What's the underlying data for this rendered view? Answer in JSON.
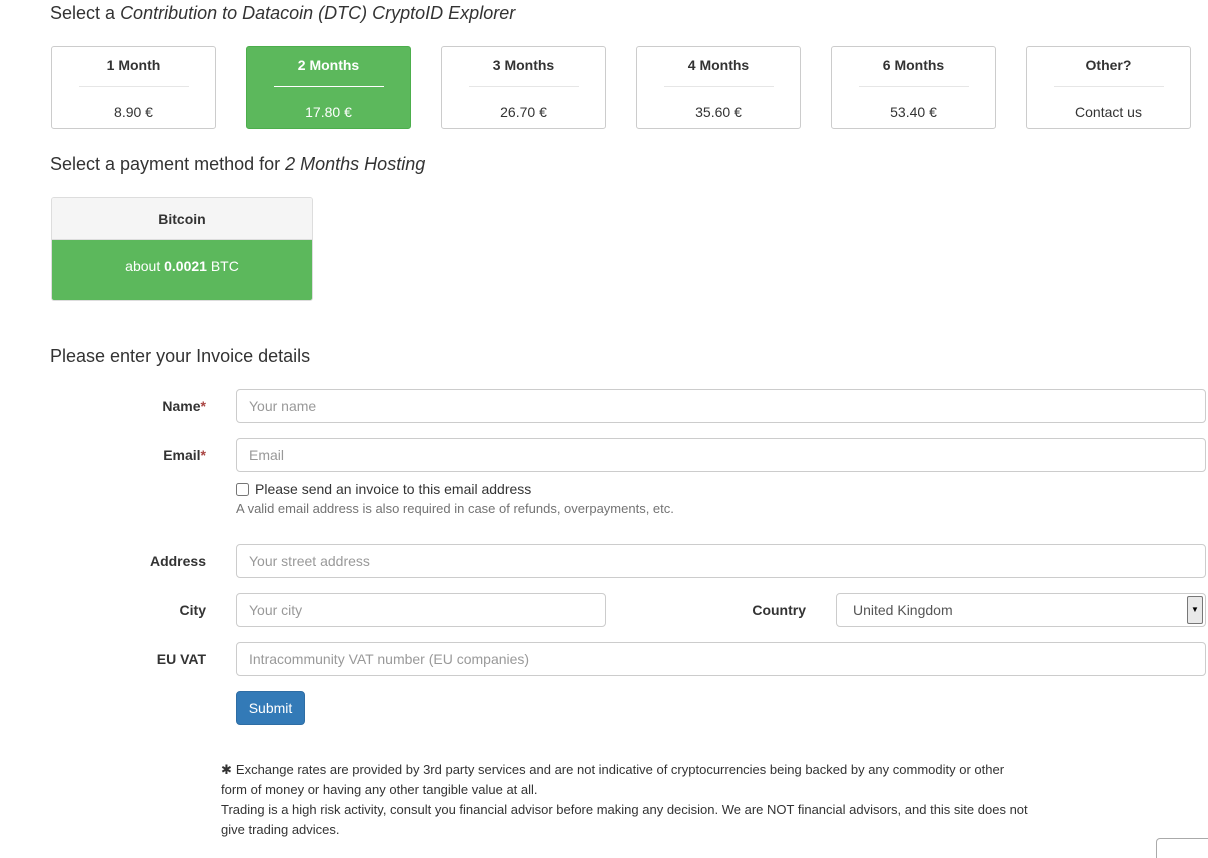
{
  "headings": {
    "contribution_prefix": "Select a",
    "contribution_italic": "Contribution to Datacoin (DTC) CryptoID Explorer",
    "payment_prefix": "Select a payment method for",
    "payment_italic": "2 Months Hosting",
    "invoice": "Please enter your Invoice details"
  },
  "plans": [
    {
      "title": "1 Month",
      "price": "8.90 €",
      "selected": false
    },
    {
      "title": "2 Months",
      "price": "17.80 €",
      "selected": true
    },
    {
      "title": "3 Months",
      "price": "26.70 €",
      "selected": false
    },
    {
      "title": "4 Months",
      "price": "35.60 €",
      "selected": false
    },
    {
      "title": "6 Months",
      "price": "53.40 €",
      "selected": false
    },
    {
      "title": "Other?",
      "price": "Contact us",
      "selected": false
    }
  ],
  "payment": {
    "method": "Bitcoin",
    "amount_prefix": "about",
    "amount_value": "0.0021",
    "amount_unit": "BTC"
  },
  "form": {
    "name_label": "Name",
    "name_placeholder": "Your name",
    "email_label": "Email",
    "email_placeholder": "Email",
    "required_mark": "*",
    "invoice_checkbox_label": "Please send an invoice to this email address",
    "email_help": "A valid email address is also required in case of refunds, overpayments, etc.",
    "address_label": "Address",
    "address_placeholder": "Your street address",
    "city_label": "City",
    "city_placeholder": "Your city",
    "country_label": "Country",
    "country_value": "United Kingdom",
    "euvat_label": "EU VAT",
    "euvat_placeholder": "Intracommunity VAT number (EU companies)",
    "submit_label": "Submit"
  },
  "disclaimer": {
    "star": "✱",
    "line1": "Exchange rates are provided by 3rd party services and are not indicative of cryptocurrencies being backed by any commodity or other form of money or having any other tangible value at all.",
    "line2": "Trading is a high risk activity, consult you financial advisor before making any decision. We are NOT financial advisors, and this site does not give trading advices."
  },
  "colors": {
    "selected_green": "#5cb85c",
    "primary_blue": "#337ab7",
    "required_red": "#a94442"
  }
}
